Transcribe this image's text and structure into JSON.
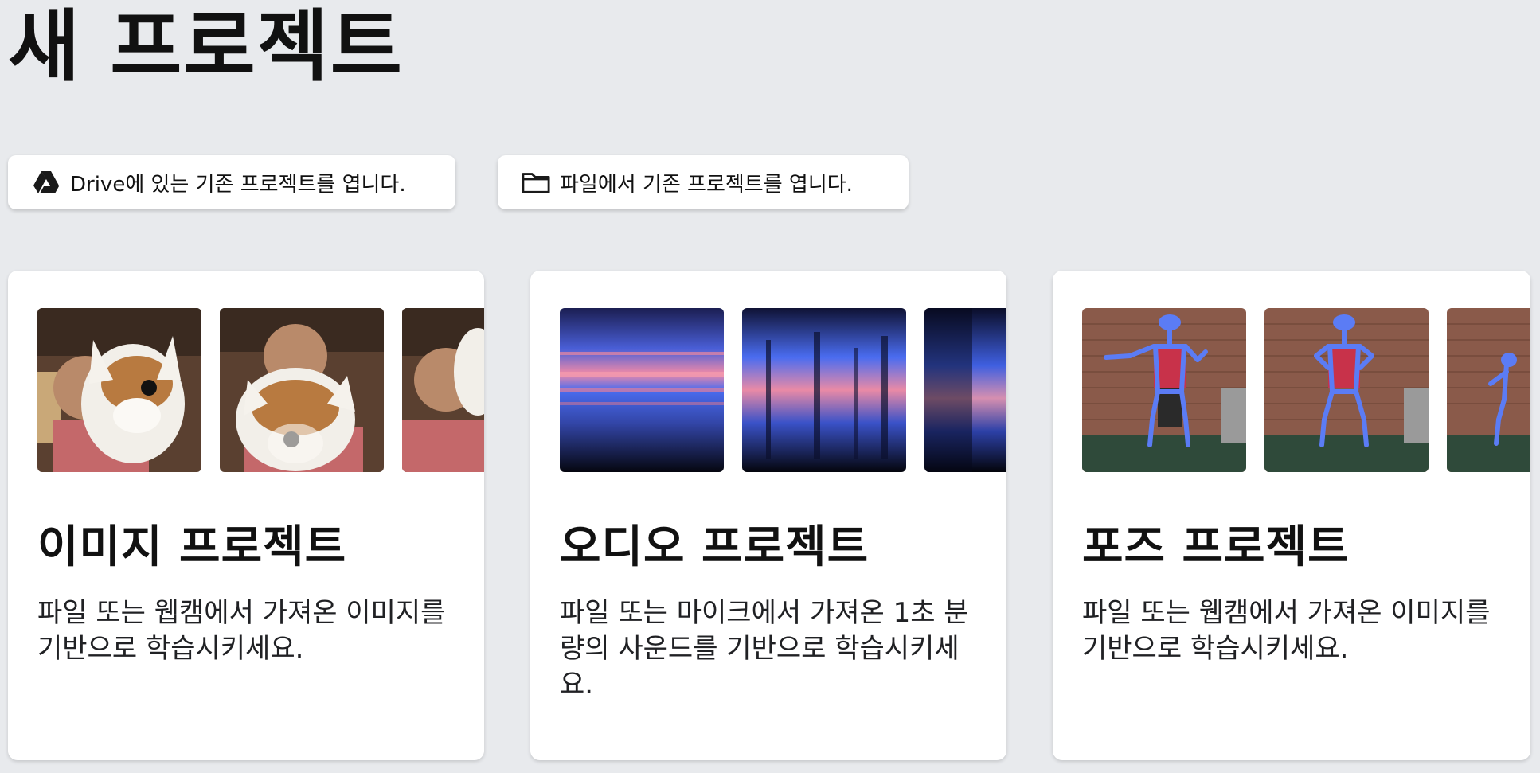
{
  "page_title": "새 프로젝트",
  "open_buttons": {
    "drive_label": "Drive에 있는 기존 프로젝트를 엽니다.",
    "drive_icon": "google-drive-icon",
    "file_label": "파일에서 기존 프로젝트를 엽니다.",
    "file_icon": "folder-icon"
  },
  "cards": [
    {
      "title": "이미지 프로젝트",
      "description": "파일 또는 웹캠에서 가져온 이미지를 기반으로 학습시키세요."
    },
    {
      "title": "오디오 프로젝트",
      "description": "파일 또는 마이크에서 가져온 1초 분량의 사운드를 기반으로 학습시키세요."
    },
    {
      "title": "포즈 프로젝트",
      "description": "파일 또는 웹캠에서 가져온 이미지를 기반으로 학습시키세요."
    }
  ],
  "colors": {
    "background": "#e8eaed",
    "card": "#ffffff",
    "spectrogram_dark": "#0b1030",
    "spectrogram_blue": "#4a6cf0",
    "spectrogram_pink": "#f08aa8",
    "pose_skeleton": "#5b7cf5"
  }
}
